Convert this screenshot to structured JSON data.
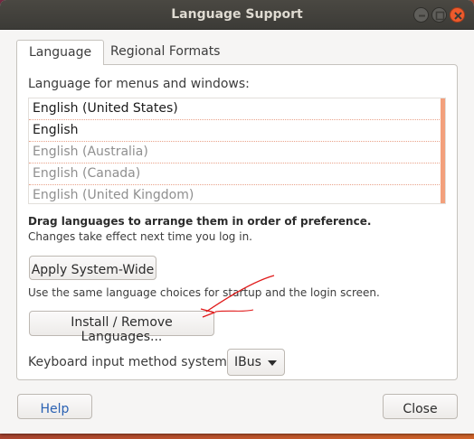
{
  "window": {
    "title": "Language Support"
  },
  "tabs": [
    {
      "label": "Language",
      "active": true
    },
    {
      "label": "Regional Formats",
      "active": false
    }
  ],
  "language_section": {
    "label": "Language for menus and windows:",
    "languages": [
      {
        "name": "English (United States)",
        "enabled": true
      },
      {
        "name": "English",
        "enabled": true
      },
      {
        "name": "English (Australia)",
        "enabled": false
      },
      {
        "name": "English (Canada)",
        "enabled": false
      },
      {
        "name": "English (United Kingdom)",
        "enabled": false
      }
    ],
    "hint_bold": "Drag languages to arrange them in order of preference.",
    "hint": "Changes take effect next time you log in."
  },
  "apply_button": {
    "label": "Apply System-Wide"
  },
  "apply_description": "Use the same language choices for startup and the login screen.",
  "install_button": {
    "label": "Install / Remove Languages..."
  },
  "keyboard": {
    "label": "Keyboard input method system:",
    "selected": "IBus"
  },
  "footer": {
    "help_label": "Help",
    "close_label": "Close"
  },
  "colors": {
    "titlebar": "#3c3b37",
    "close_button": "#ee5a2c",
    "help_link": "#2a61b3",
    "annotation": "#e01818"
  },
  "icons": [
    "minimize-icon",
    "maximize-icon",
    "close-icon",
    "chevron-down-icon"
  ]
}
